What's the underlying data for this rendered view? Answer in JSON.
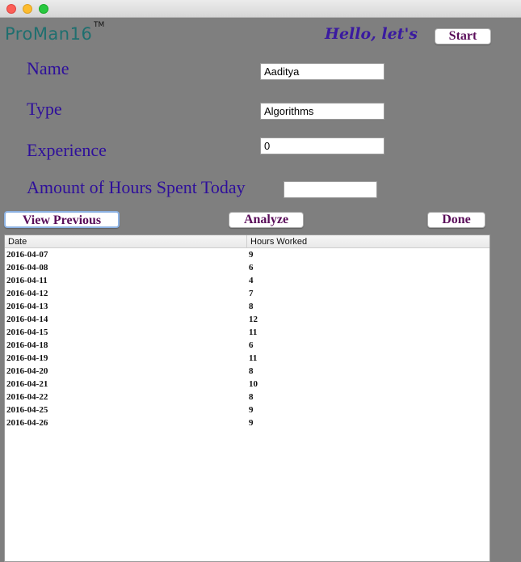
{
  "app": {
    "logo": "ProMan16",
    "trademark": "TM",
    "greeting": "Hello, let's",
    "start_label": "Start"
  },
  "form": {
    "name_label": "Name",
    "name_value": "Aaditya",
    "type_label": "Type",
    "type_value": "Algorithms",
    "experience_label": "Experience",
    "experience_value": "0",
    "hours_label": "Amount of Hours Spent Today",
    "hours_value": ""
  },
  "actions": {
    "view_previous": "View Previous",
    "analyze": "Analyze",
    "done": "Done"
  },
  "table": {
    "columns": [
      "Date",
      "Hours Worked"
    ],
    "rows": [
      [
        "2016-04-07",
        "9"
      ],
      [
        "2016-04-08",
        "6"
      ],
      [
        "2016-04-11",
        "4"
      ],
      [
        "2016-04-12",
        "7"
      ],
      [
        "2016-04-13",
        "8"
      ],
      [
        "2016-04-14",
        "12"
      ],
      [
        "2016-04-15",
        "11"
      ],
      [
        "2016-04-18",
        "6"
      ],
      [
        "2016-04-19",
        "11"
      ],
      [
        "2016-04-20",
        "8"
      ],
      [
        "2016-04-21",
        "10"
      ],
      [
        "2016-04-22",
        "8"
      ],
      [
        "2016-04-25",
        "9"
      ],
      [
        "2016-04-26",
        "9"
      ]
    ]
  }
}
